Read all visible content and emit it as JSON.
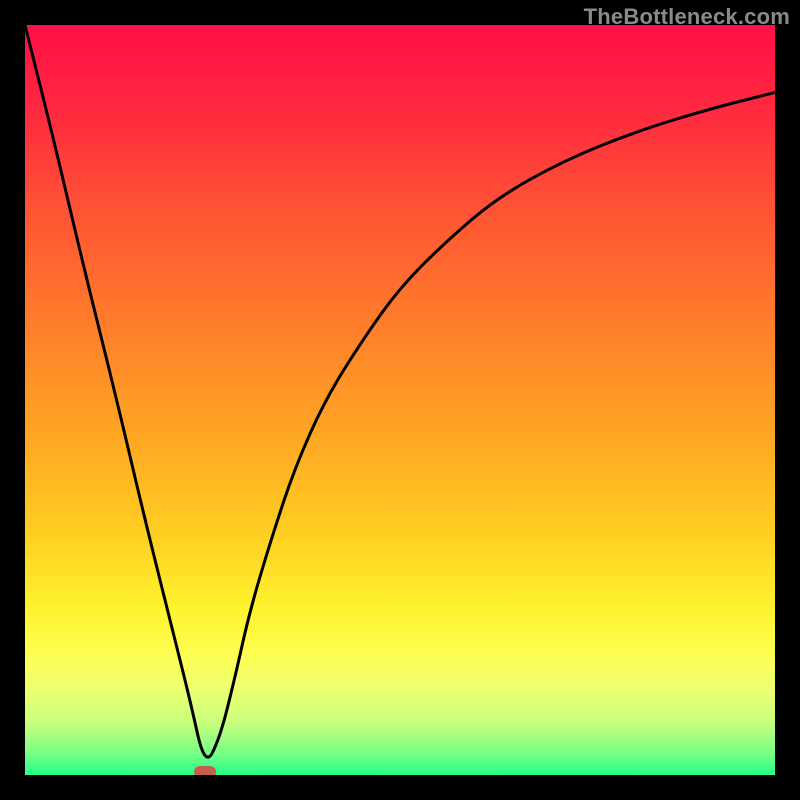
{
  "watermark": "TheBottleneck.com",
  "gradient_stops": [
    {
      "pct": 0,
      "color": "#ff0f46"
    },
    {
      "pct": 12,
      "color": "#ff2b3f"
    },
    {
      "pct": 25,
      "color": "#ff5433"
    },
    {
      "pct": 40,
      "color": "#ff7e2a"
    },
    {
      "pct": 55,
      "color": "#ffa723"
    },
    {
      "pct": 68,
      "color": "#ffcf22"
    },
    {
      "pct": 78,
      "color": "#fff32e"
    },
    {
      "pct": 84,
      "color": "#fdff52"
    },
    {
      "pct": 88,
      "color": "#f1ff6e"
    },
    {
      "pct": 93,
      "color": "#c7ff7e"
    },
    {
      "pct": 97,
      "color": "#7aff84"
    },
    {
      "pct": 100,
      "color": "#23ff86"
    }
  ],
  "marker": {
    "x_pct": 24,
    "color": "#c95b53"
  },
  "chart_data": {
    "type": "line",
    "title": "",
    "xlabel": "",
    "ylabel": "",
    "xlim": [
      0,
      100
    ],
    "ylim": [
      0,
      100
    ],
    "series": [
      {
        "name": "bottleneck-curve",
        "x": [
          0,
          4,
          8,
          12,
          16,
          20,
          22,
          24,
          26,
          28,
          30,
          33,
          36,
          40,
          45,
          50,
          56,
          63,
          72,
          82,
          92,
          100
        ],
        "y": [
          100,
          84,
          67,
          51,
          34,
          18,
          10,
          1,
          5,
          13,
          22,
          32,
          41,
          50,
          58,
          65,
          71,
          77,
          82,
          86,
          89,
          91
        ]
      }
    ],
    "annotations": [
      {
        "text": "TheBottleneck.com",
        "pos": "top-right"
      }
    ],
    "background_gradient": "vertical red→orange→yellow→green",
    "optimum_marker_x": 24
  }
}
